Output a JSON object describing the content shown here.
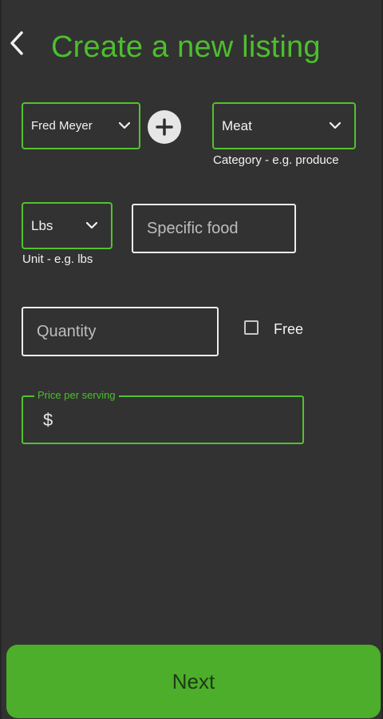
{
  "header": {
    "back_icon": "chevron-left-icon",
    "title": "Create a new listing"
  },
  "form": {
    "store": {
      "value": "Fred Meyer",
      "icon": "chevron-down-icon"
    },
    "add_store_icon": "plus-circle-icon",
    "category": {
      "value": "Meat",
      "helper": "Category - e.g. produce",
      "icon": "chevron-down-icon"
    },
    "unit": {
      "value": "Lbs",
      "helper": "Unit - e.g. lbs",
      "icon": "chevron-down-icon"
    },
    "specific_food": {
      "placeholder": "Specific food"
    },
    "quantity": {
      "placeholder": "Quantity"
    },
    "free": {
      "label": "Free",
      "checked": false
    },
    "price": {
      "label": "Price per serving",
      "prefix": "$",
      "value": ""
    }
  },
  "footer": {
    "next_label": "Next"
  },
  "colors": {
    "accent": "#4cbf2c",
    "button": "#4cae2a",
    "background": "#323232"
  }
}
